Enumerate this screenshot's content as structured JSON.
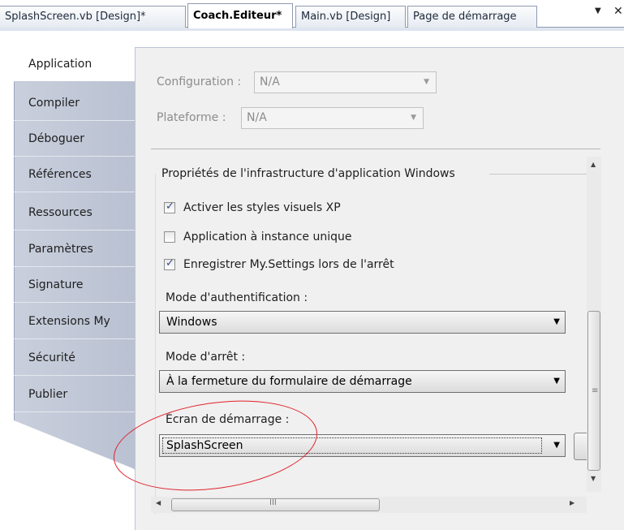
{
  "document_tabs": [
    {
      "label": "SplashScreen.vb [Design]*",
      "active": false
    },
    {
      "label": "Coach.Editeur*",
      "active": true
    },
    {
      "label": "Main.vb [Design]",
      "active": false
    },
    {
      "label": "Page de démarrage",
      "active": false
    }
  ],
  "tab_controls": {
    "overflow_icon": "▼",
    "close_icon": "✕"
  },
  "sidebar": {
    "items": [
      {
        "label": "Application",
        "active": true
      },
      {
        "label": "Compiler"
      },
      {
        "label": "Déboguer"
      },
      {
        "label": "Références"
      },
      {
        "label": "Ressources"
      },
      {
        "label": "Paramètres"
      },
      {
        "label": "Signature"
      },
      {
        "label": "Extensions My"
      },
      {
        "label": "Sécurité"
      },
      {
        "label": "Publier"
      }
    ]
  },
  "config": {
    "configuration_label": "Configuration :",
    "configuration_value": "N/A",
    "platform_label": "Plateforme :",
    "platform_value": "N/A"
  },
  "framework": {
    "group_title": "Propriétés de l'infrastructure d'application Windows",
    "checkboxes": [
      {
        "label": "Activer les styles visuels XP",
        "checked": true
      },
      {
        "label": "Application à instance unique",
        "checked": false
      },
      {
        "label": "Enregistrer My.Settings lors de l'arrêt",
        "checked": true
      }
    ],
    "auth_label": "Mode d'authentification :",
    "auth_value": "Windows",
    "shutdown_label": "Mode d'arrêt :",
    "shutdown_value": "À la fermeture du formulaire de démarrage",
    "splash_label": "Écran de démarrage :",
    "splash_value": "SplashScreen"
  },
  "scrollbar": {
    "horizontal_grip": "III",
    "vertical_grip": "≡"
  },
  "annotation_color": "#e0202a"
}
